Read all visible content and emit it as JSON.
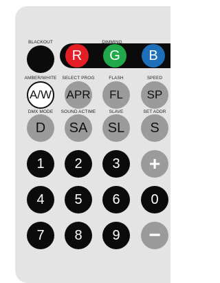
{
  "colors": {
    "body": "#e4e4e4",
    "black_btn": "#0b0b0b",
    "gray_btn": "#9b9b9b",
    "red": "#e41e26",
    "green": "#21a84a",
    "blue": "#1e6fba"
  },
  "labels": {
    "blackout": "BLACKOUT",
    "dimming": "DIMMING",
    "amber_white": "AMBER/WHITE",
    "select_prog": "SELECT PROG",
    "flash": "FLASH",
    "speed": "SPEED",
    "dmx_mode": "DMX MODE",
    "sound_actime": "SOUND ACTIME",
    "slave": "SLAVE",
    "set_addr": "SET ADDR"
  },
  "buttons": {
    "red": "R",
    "green": "G",
    "blue": "B",
    "aw": "A/W",
    "apr": "APR",
    "fl": "FL",
    "sp": "SP",
    "d": "D",
    "sa": "SA",
    "sl": "SL",
    "s": "S",
    "n1": "1",
    "n2": "2",
    "n3": "3",
    "plus": "+",
    "n4": "4",
    "n5": "5",
    "n6": "6",
    "n0": "0",
    "n7": "7",
    "n8": "8",
    "n9": "9",
    "minus": "−"
  }
}
